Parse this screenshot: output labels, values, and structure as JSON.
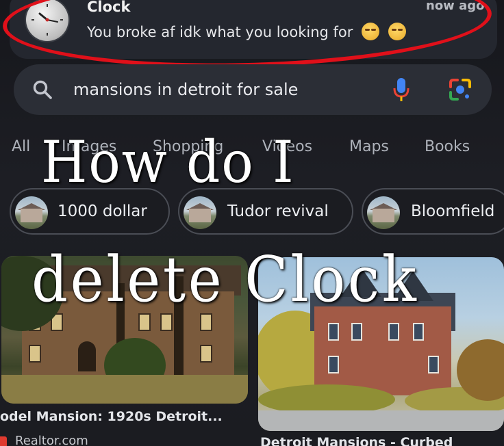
{
  "notification": {
    "app_name": "Clock",
    "time": "now ago",
    "message": "You broke af idk what you looking for",
    "emojis": [
      "😩",
      "😩"
    ],
    "icon": "clock-icon",
    "highlight_color": "#e0101a"
  },
  "search": {
    "query": "mansions in detroit for sale",
    "icons": [
      "search-icon",
      "mic-icon",
      "lens-icon"
    ]
  },
  "tabs": [
    {
      "label": "All"
    },
    {
      "label": "Images"
    },
    {
      "label": "Shopping"
    },
    {
      "label": "Videos"
    },
    {
      "label": "Maps"
    },
    {
      "label": "Books"
    }
  ],
  "chips": [
    {
      "label": "1000 dollar"
    },
    {
      "label": "Tudor revival"
    },
    {
      "label": "Bloomfield"
    }
  ],
  "results": [
    {
      "caption": "odel Mansion: 1920s Detroit...",
      "source": "Realtor.com"
    },
    {
      "caption": "Detroit Mansions - Curbed",
      "source": ""
    }
  ],
  "overlay": {
    "line1": "How do I",
    "line2": "delete Clock"
  }
}
